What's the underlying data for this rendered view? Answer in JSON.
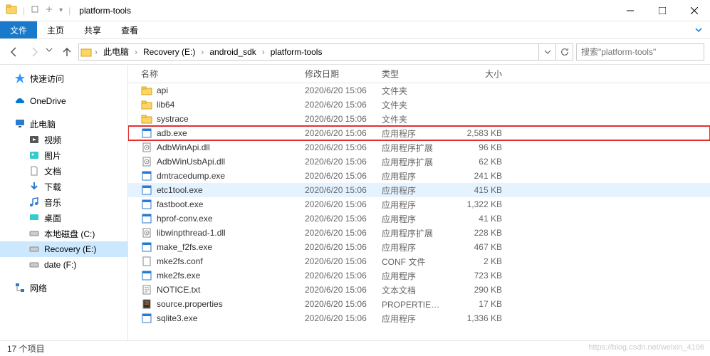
{
  "window": {
    "title": "platform-tools"
  },
  "menu": {
    "file": "文件",
    "home": "主页",
    "share": "共享",
    "view": "查看"
  },
  "breadcrumb": {
    "items": [
      "此电脑",
      "Recovery (E:)",
      "android_sdk",
      "platform-tools"
    ]
  },
  "search": {
    "placeholder": "搜索\"platform-tools\""
  },
  "sidebar": {
    "quick_access": "快速访问",
    "onedrive": "OneDrive",
    "this_pc": "此电脑",
    "videos": "视频",
    "pictures": "图片",
    "documents": "文档",
    "downloads": "下载",
    "music": "音乐",
    "desktop": "桌面",
    "disk_c": "本地磁盘 (C:)",
    "disk_e": "Recovery (E:)",
    "disk_f": "date (F:)",
    "network": "网络"
  },
  "columns": {
    "name": "名称",
    "date": "修改日期",
    "type": "类型",
    "size": "大小"
  },
  "files": [
    {
      "name": "api",
      "date": "2020/6/20 15:06",
      "type": "文件夹",
      "size": "",
      "icon": "folder"
    },
    {
      "name": "lib64",
      "date": "2020/6/20 15:06",
      "type": "文件夹",
      "size": "",
      "icon": "folder"
    },
    {
      "name": "systrace",
      "date": "2020/6/20 15:06",
      "type": "文件夹",
      "size": "",
      "icon": "folder"
    },
    {
      "name": "adb.exe",
      "date": "2020/6/20 15:06",
      "type": "应用程序",
      "size": "2,583 KB",
      "icon": "exe",
      "highlight": true
    },
    {
      "name": "AdbWinApi.dll",
      "date": "2020/6/20 15:06",
      "type": "应用程序扩展",
      "size": "96 KB",
      "icon": "dll"
    },
    {
      "name": "AdbWinUsbApi.dll",
      "date": "2020/6/20 15:06",
      "type": "应用程序扩展",
      "size": "62 KB",
      "icon": "dll"
    },
    {
      "name": "dmtracedump.exe",
      "date": "2020/6/20 15:06",
      "type": "应用程序",
      "size": "241 KB",
      "icon": "exe"
    },
    {
      "name": "etc1tool.exe",
      "date": "2020/6/20 15:06",
      "type": "应用程序",
      "size": "415 KB",
      "icon": "exe",
      "hover": true
    },
    {
      "name": "fastboot.exe",
      "date": "2020/6/20 15:06",
      "type": "应用程序",
      "size": "1,322 KB",
      "icon": "exe"
    },
    {
      "name": "hprof-conv.exe",
      "date": "2020/6/20 15:06",
      "type": "应用程序",
      "size": "41 KB",
      "icon": "exe"
    },
    {
      "name": "libwinpthread-1.dll",
      "date": "2020/6/20 15:06",
      "type": "应用程序扩展",
      "size": "228 KB",
      "icon": "dll"
    },
    {
      "name": "make_f2fs.exe",
      "date": "2020/6/20 15:06",
      "type": "应用程序",
      "size": "467 KB",
      "icon": "exe"
    },
    {
      "name": "mke2fs.conf",
      "date": "2020/6/20 15:06",
      "type": "CONF 文件",
      "size": "2 KB",
      "icon": "file"
    },
    {
      "name": "mke2fs.exe",
      "date": "2020/6/20 15:06",
      "type": "应用程序",
      "size": "723 KB",
      "icon": "exe"
    },
    {
      "name": "NOTICE.txt",
      "date": "2020/6/20 15:06",
      "type": "文本文档",
      "size": "290 KB",
      "icon": "txt"
    },
    {
      "name": "source.properties",
      "date": "2020/6/20 15:06",
      "type": "PROPERTIES 文件",
      "size": "17 KB",
      "icon": "props"
    },
    {
      "name": "sqlite3.exe",
      "date": "2020/6/20 15:06",
      "type": "应用程序",
      "size": "1,336 KB",
      "icon": "exe"
    }
  ],
  "status": {
    "count": "17 个项目"
  },
  "watermark": "https://blog.csdn.net/weixin_4106"
}
